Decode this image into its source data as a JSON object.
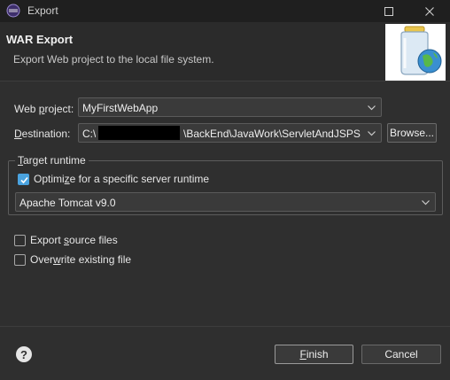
{
  "window": {
    "title": "Export",
    "maximize_icon": "maximize-icon",
    "close_icon": "close-icon"
  },
  "banner": {
    "title": "WAR Export",
    "description": "Export Web project to the local file system.",
    "image_icon": "war-jar-globe-icon"
  },
  "form": {
    "web_project_label": "Web project:",
    "web_project_value": "MyFirstWebApp",
    "destination_label": "Destination:",
    "destination_prefix": "C:\\",
    "destination_suffix": "\\BackEnd\\JavaWork\\ServletAndJSPS",
    "browse_label": "Browse..."
  },
  "target_runtime": {
    "group_label": "Target runtime",
    "optimize_label": "Optimize for a specific server runtime",
    "optimize_checked": true,
    "runtime_value": "Apache Tomcat v9.0"
  },
  "options": {
    "export_source_label": "Export source files",
    "export_source_checked": false,
    "overwrite_label": "Overwrite existing file",
    "overwrite_checked": false
  },
  "footer": {
    "help_icon": "help-icon",
    "finish_label": "Finish",
    "cancel_label": "Cancel"
  },
  "colors": {
    "accent": "#4aa3df",
    "background": "#2f2f2f",
    "titlebar": "#1f1f1f"
  }
}
